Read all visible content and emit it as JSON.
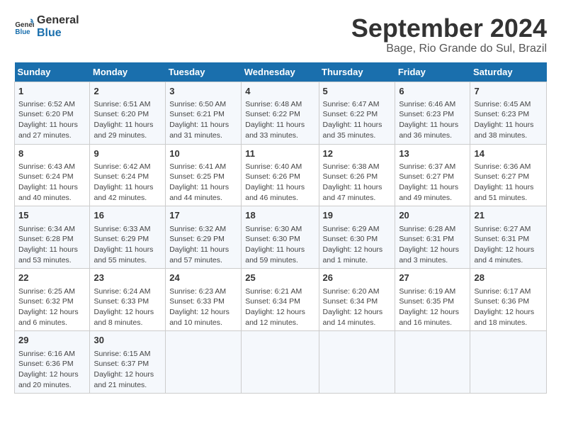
{
  "logo": {
    "line1": "General",
    "line2": "Blue"
  },
  "title": "September 2024",
  "subtitle": "Bage, Rio Grande do Sul, Brazil",
  "days_header": [
    "Sunday",
    "Monday",
    "Tuesday",
    "Wednesday",
    "Thursday",
    "Friday",
    "Saturday"
  ],
  "weeks": [
    [
      {
        "day": "1",
        "text": "Sunrise: 6:52 AM\nSunset: 6:20 PM\nDaylight: 11 hours and 27 minutes."
      },
      {
        "day": "2",
        "text": "Sunrise: 6:51 AM\nSunset: 6:20 PM\nDaylight: 11 hours and 29 minutes."
      },
      {
        "day": "3",
        "text": "Sunrise: 6:50 AM\nSunset: 6:21 PM\nDaylight: 11 hours and 31 minutes."
      },
      {
        "day": "4",
        "text": "Sunrise: 6:48 AM\nSunset: 6:22 PM\nDaylight: 11 hours and 33 minutes."
      },
      {
        "day": "5",
        "text": "Sunrise: 6:47 AM\nSunset: 6:22 PM\nDaylight: 11 hours and 35 minutes."
      },
      {
        "day": "6",
        "text": "Sunrise: 6:46 AM\nSunset: 6:23 PM\nDaylight: 11 hours and 36 minutes."
      },
      {
        "day": "7",
        "text": "Sunrise: 6:45 AM\nSunset: 6:23 PM\nDaylight: 11 hours and 38 minutes."
      }
    ],
    [
      {
        "day": "8",
        "text": "Sunrise: 6:43 AM\nSunset: 6:24 PM\nDaylight: 11 hours and 40 minutes."
      },
      {
        "day": "9",
        "text": "Sunrise: 6:42 AM\nSunset: 6:24 PM\nDaylight: 11 hours and 42 minutes."
      },
      {
        "day": "10",
        "text": "Sunrise: 6:41 AM\nSunset: 6:25 PM\nDaylight: 11 hours and 44 minutes."
      },
      {
        "day": "11",
        "text": "Sunrise: 6:40 AM\nSunset: 6:26 PM\nDaylight: 11 hours and 46 minutes."
      },
      {
        "day": "12",
        "text": "Sunrise: 6:38 AM\nSunset: 6:26 PM\nDaylight: 11 hours and 47 minutes."
      },
      {
        "day": "13",
        "text": "Sunrise: 6:37 AM\nSunset: 6:27 PM\nDaylight: 11 hours and 49 minutes."
      },
      {
        "day": "14",
        "text": "Sunrise: 6:36 AM\nSunset: 6:27 PM\nDaylight: 11 hours and 51 minutes."
      }
    ],
    [
      {
        "day": "15",
        "text": "Sunrise: 6:34 AM\nSunset: 6:28 PM\nDaylight: 11 hours and 53 minutes."
      },
      {
        "day": "16",
        "text": "Sunrise: 6:33 AM\nSunset: 6:29 PM\nDaylight: 11 hours and 55 minutes."
      },
      {
        "day": "17",
        "text": "Sunrise: 6:32 AM\nSunset: 6:29 PM\nDaylight: 11 hours and 57 minutes."
      },
      {
        "day": "18",
        "text": "Sunrise: 6:30 AM\nSunset: 6:30 PM\nDaylight: 11 hours and 59 minutes."
      },
      {
        "day": "19",
        "text": "Sunrise: 6:29 AM\nSunset: 6:30 PM\nDaylight: 12 hours and 1 minute."
      },
      {
        "day": "20",
        "text": "Sunrise: 6:28 AM\nSunset: 6:31 PM\nDaylight: 12 hours and 3 minutes."
      },
      {
        "day": "21",
        "text": "Sunrise: 6:27 AM\nSunset: 6:31 PM\nDaylight: 12 hours and 4 minutes."
      }
    ],
    [
      {
        "day": "22",
        "text": "Sunrise: 6:25 AM\nSunset: 6:32 PM\nDaylight: 12 hours and 6 minutes."
      },
      {
        "day": "23",
        "text": "Sunrise: 6:24 AM\nSunset: 6:33 PM\nDaylight: 12 hours and 8 minutes."
      },
      {
        "day": "24",
        "text": "Sunrise: 6:23 AM\nSunset: 6:33 PM\nDaylight: 12 hours and 10 minutes."
      },
      {
        "day": "25",
        "text": "Sunrise: 6:21 AM\nSunset: 6:34 PM\nDaylight: 12 hours and 12 minutes."
      },
      {
        "day": "26",
        "text": "Sunrise: 6:20 AM\nSunset: 6:34 PM\nDaylight: 12 hours and 14 minutes."
      },
      {
        "day": "27",
        "text": "Sunrise: 6:19 AM\nSunset: 6:35 PM\nDaylight: 12 hours and 16 minutes."
      },
      {
        "day": "28",
        "text": "Sunrise: 6:17 AM\nSunset: 6:36 PM\nDaylight: 12 hours and 18 minutes."
      }
    ],
    [
      {
        "day": "29",
        "text": "Sunrise: 6:16 AM\nSunset: 6:36 PM\nDaylight: 12 hours and 20 minutes."
      },
      {
        "day": "30",
        "text": "Sunrise: 6:15 AM\nSunset: 6:37 PM\nDaylight: 12 hours and 21 minutes."
      },
      {
        "day": "",
        "text": ""
      },
      {
        "day": "",
        "text": ""
      },
      {
        "day": "",
        "text": ""
      },
      {
        "day": "",
        "text": ""
      },
      {
        "day": "",
        "text": ""
      }
    ]
  ]
}
